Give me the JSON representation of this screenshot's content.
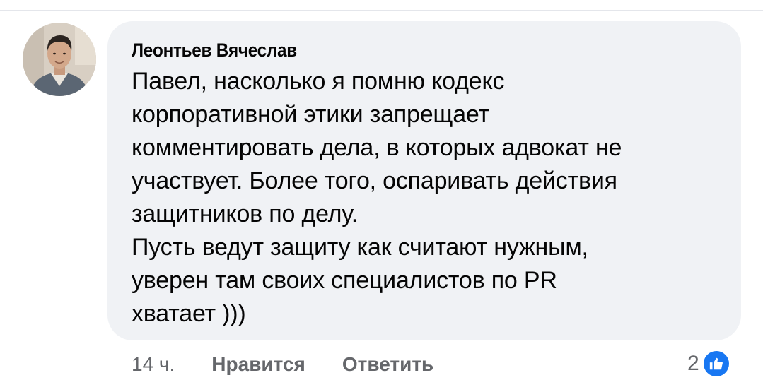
{
  "comment": {
    "author": "Леонтьев Вячеслав",
    "lines": [
      "Павел, насколько я помню кодекс",
      "корпоративной этики запрещает",
      "комментировать дела, в которых адвокат не",
      "участвует. Более того, оспаривать действия",
      "защитников по делу.",
      "Пусть ведут защиту как считают нужным,",
      "уверен там своих специалистов по PR",
      "хватает )))"
    ]
  },
  "actions": {
    "time": "14 ч.",
    "like_label": "Нравится",
    "reply_label": "Ответить"
  },
  "reactions": {
    "count": "2",
    "icon": "thumbs-up-icon",
    "color": "#1877f2"
  },
  "colors": {
    "bubble": "#f0f2f5",
    "text": "#050505",
    "secondary": "#65676b"
  }
}
